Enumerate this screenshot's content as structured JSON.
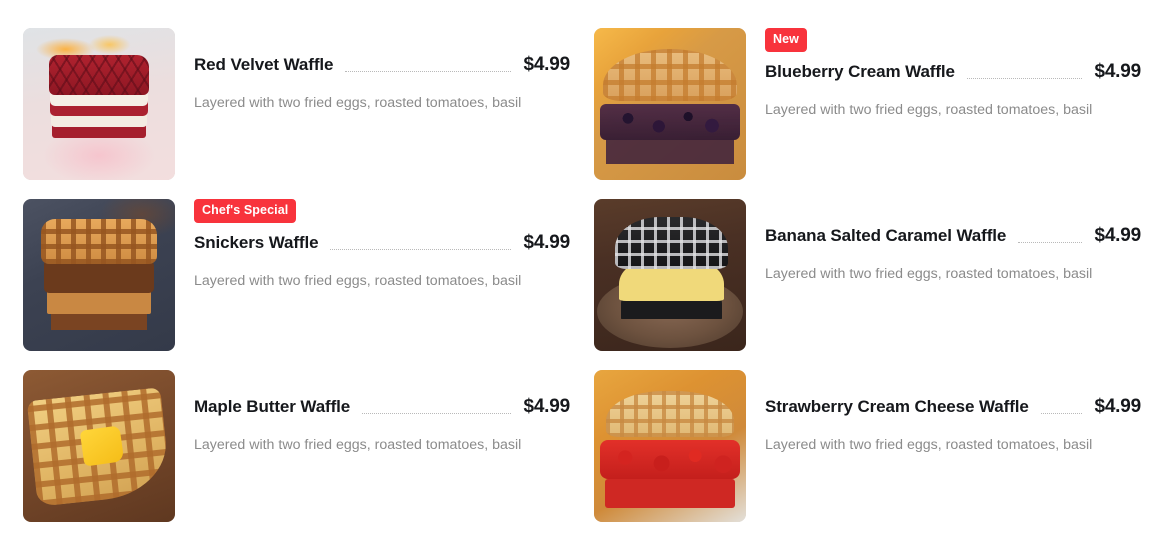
{
  "menu": {
    "currency_symbol": "$",
    "badge_color": "#f8333c",
    "title_color": "#16181c",
    "description_color": "#8b8b8b",
    "leader_color": "#b9b9b9",
    "columns": [
      {
        "side": "left",
        "items": [
          {
            "badge": "",
            "title": "Red Velvet Waffle",
            "price": "$4.99",
            "description": "Layered with two fried eggs, roasted tomatoes, basil",
            "image_alt": "red-velvet-waffle-photo"
          },
          {
            "badge": "Chef's Special",
            "title": "Snickers Waffle",
            "price": "$4.99",
            "description": "Layered with two fried eggs, roasted tomatoes, basil",
            "image_alt": "snickers-waffle-photo"
          },
          {
            "badge": "",
            "title": "Maple Butter Waffle",
            "price": "$4.99",
            "description": "Layered with two fried eggs, roasted tomatoes, basil",
            "image_alt": "maple-butter-waffle-photo"
          }
        ]
      },
      {
        "side": "right",
        "items": [
          {
            "badge": "New",
            "title": "Blueberry Cream Waffle",
            "price": "$4.99",
            "description": "Layered with two fried eggs, roasted tomatoes, basil",
            "image_alt": "blueberry-cream-waffle-photo"
          },
          {
            "badge": "",
            "title": "Banana Salted Caramel Waffle",
            "price": "$4.99",
            "description": "Layered with two fried eggs, roasted tomatoes, basil",
            "image_alt": "banana-salted-caramel-waffle-photo"
          },
          {
            "badge": "",
            "title": "Strawberry Cream Cheese Waffle",
            "price": "$4.99",
            "description": "Layered with two fried eggs, roasted tomatoes, basil",
            "image_alt": "strawberry-cream-cheese-waffle-photo"
          }
        ]
      }
    ]
  }
}
